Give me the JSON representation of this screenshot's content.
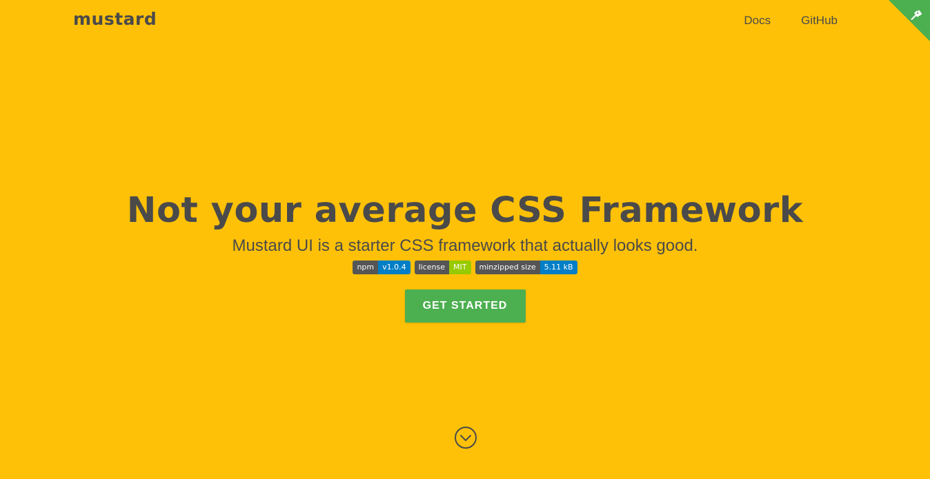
{
  "nav": {
    "brand": "mustard",
    "links": [
      "Docs",
      "GitHub"
    ]
  },
  "hero": {
    "title": "Not your average CSS Framework",
    "subtitle": "Mustard UI is a starter CSS framework that actually looks good.",
    "badges": [
      {
        "label": "npm",
        "value": "v1.0.4",
        "color": "#007ec6"
      },
      {
        "label": "license",
        "value": "MIT",
        "color": "#97ca00"
      },
      {
        "label": "minzipped size",
        "value": "5.11 kB",
        "color": "#007ec6"
      }
    ],
    "cta": "GET STARTED"
  },
  "icons": {
    "corner": "github-octocat-icon",
    "scroll": "chevron-down-circle-icon"
  },
  "colors": {
    "background": "#FFC107",
    "accent": "#4CAF50",
    "text": "#4a4a4a"
  }
}
